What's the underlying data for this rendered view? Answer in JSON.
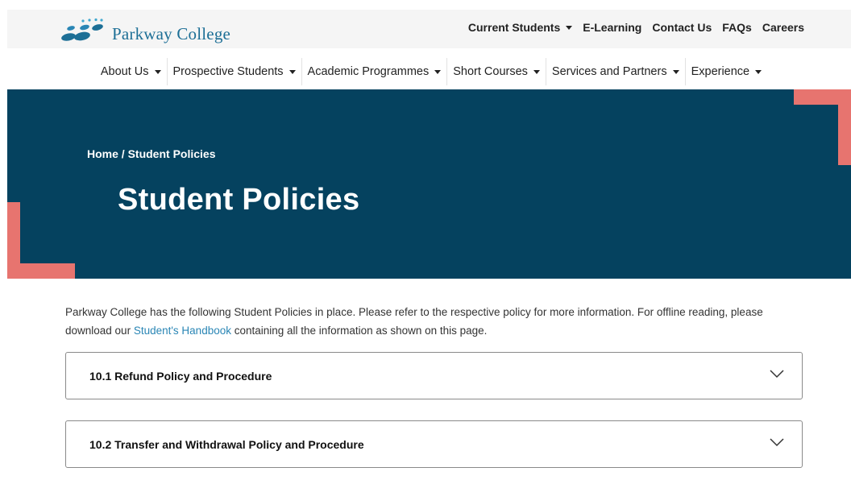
{
  "brand": {
    "name": "Parkway College"
  },
  "utility_nav": [
    {
      "label": "Current Students",
      "dropdown": true
    },
    {
      "label": "E-Learning",
      "dropdown": false
    },
    {
      "label": "Contact Us",
      "dropdown": false
    },
    {
      "label": "FAQs",
      "dropdown": false
    },
    {
      "label": "Careers",
      "dropdown": false
    }
  ],
  "main_nav": [
    {
      "label": "About Us"
    },
    {
      "label": "Prospective Students"
    },
    {
      "label": "Academic Programmes"
    },
    {
      "label": "Short Courses"
    },
    {
      "label": "Services and Partners"
    },
    {
      "label": "Experience"
    }
  ],
  "hero": {
    "breadcrumb_home": "Home",
    "breadcrumb_sep": " / ",
    "breadcrumb_current": "Student Policies",
    "title": "Student Policies"
  },
  "intro": {
    "text_before": "Parkway College has the following Student Policies in place. Please refer to the respective policy for more information. For offline reading, please download our ",
    "link": "Student's Handbook",
    "text_after": " containing all the information as shown on this page."
  },
  "accordions": [
    {
      "title": "10.1 Refund Policy and Procedure"
    },
    {
      "title": "10.2 Transfer and Withdrawal Policy and Procedure"
    }
  ],
  "colors": {
    "hero_bg": "#05425f",
    "accent": "#e7746f",
    "link": "#2a86b5",
    "brand": "#1d6f96"
  }
}
